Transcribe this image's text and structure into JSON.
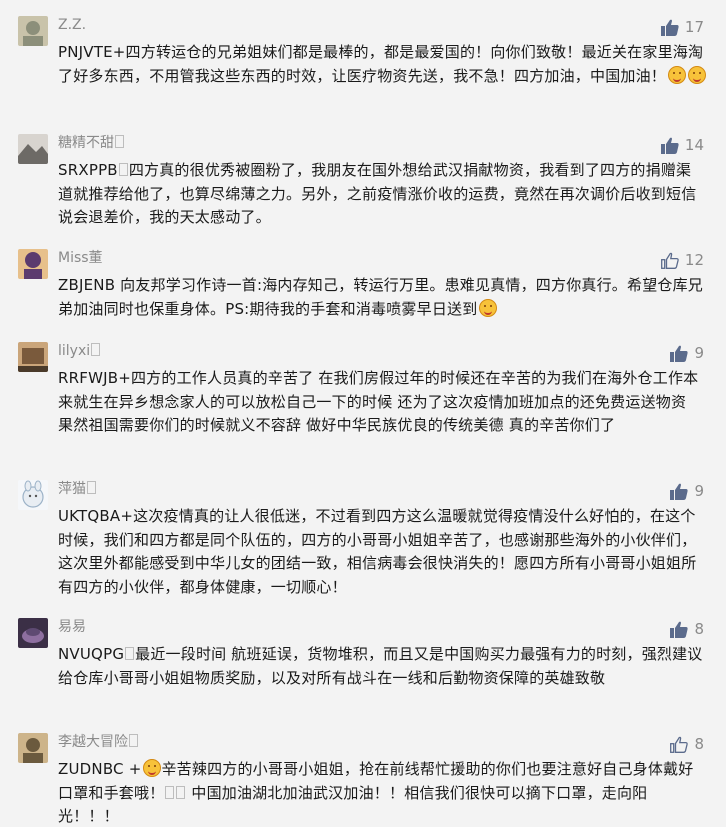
{
  "comments": [
    {
      "name": "Z.Z.",
      "likes": "17",
      "liked": true,
      "avatar_colors": [
        "#8c8f7a",
        "#c9c3aa"
      ],
      "avatar_icon": "avatar-photo-icon",
      "text": "PNJVTE+四方转运仓的兄弟姐妹们都是最棒的，都是最爱国的！向你们致敬！最近关在家里海淘了好多东西，不用管我这些东西的时效，让医疗物资先送，我不急！四方加油，中国加油！",
      "emojis": 2
    },
    {
      "name": "糖精不甜",
      "likes": "14",
      "liked": true,
      "avatar_colors": [
        "#6d6a66",
        "#d8d4cf"
      ],
      "avatar_icon": "avatar-photo-icon",
      "text": "SRXPPB",
      "text_rest": "四方真的很优秀被圈粉了，我朋友在国外想给武汉捐献物资，我看到了四方的捐赠渠道就推荐给他了，也算尽绵薄之力。另外，之前疫情涨价收的运费，竟然在再次调价后收到短信说会退差价，我的天太感动了。"
    },
    {
      "name": "Miss董",
      "likes": "12",
      "liked": false,
      "avatar_colors": [
        "#5b3b6e",
        "#e7c08b"
      ],
      "avatar_icon": "avatar-photo-icon",
      "text": "ZBJENB 向友邦学习作诗一首:海内存知己，转运行万里。患难见真情，四方你真行。希望仓库兄弟加油同时也保重身体。PS:期待我的手套和消毒喷雾早日送到",
      "emojis": 1
    },
    {
      "name": "lilyxi",
      "likes": "9",
      "liked": true,
      "avatar_colors": [
        "#7a5a3c",
        "#caa57a"
      ],
      "avatar_icon": "avatar-photo-icon",
      "text": "RRFWJB+四方的工作人员真的辛苦了 在我们房假过年的时候还在辛苦的为我们在海外仓工作本来就生在异乡想念家人的可以放松自己一下的时候 还为了这次疫情加班加点的还免费运送物资 果然祖国需要你们的时候就义不容辞 做好中华民族优良的传统美德 真的辛苦你们了"
    },
    {
      "name": "萍猫",
      "likes": "9",
      "liked": true,
      "avatar_colors": [
        "#e8edf3",
        "#9db3c8"
      ],
      "avatar_icon": "avatar-cartoon-icon",
      "text": "UKTQBA+这次疫情真的让人很低迷，不过看到四方这么温暖就觉得疫情没什么好怕的，在这个时候，我们和四方都是同个队伍的，四方的小哥哥小姐姐辛苦了，也感谢那些海外的小伙伴们，这次里外都能感受到中华儿女的团结一致，相信病毒会很快消失的！愿四方所有小哥哥小姐姐所有四方的小伙伴，都身体健康，一切顺心！"
    },
    {
      "name": "易易",
      "likes": "8",
      "liked": true,
      "avatar_colors": [
        "#3b2f46",
        "#8e6fa0"
      ],
      "avatar_icon": "avatar-photo-icon",
      "text": "NVUQPG",
      "text_rest": "最近一段时间 航班延误，货物堆积，而且又是中国购买力最强有力的时刻，强烈建议给仓库小哥哥小姐姐物质奖励，以及对所有战斗在一线和后勤物资保障的英雄致敬"
    },
    {
      "name": "李越大冒险",
      "likes": "8",
      "liked": false,
      "avatar_colors": [
        "#6b5a3e",
        "#cdb48a"
      ],
      "avatar_icon": "avatar-photo-icon",
      "text": "ZUDNBC +",
      "text_rest": "辛苦辣四方的小哥哥小姐姐，抢在前线帮忙援助的你们也要注意好自己身体戴好口罩和手套哦！",
      "text_tail": " 中国加油湖北加油武汉加油！！相信我们很快可以摘下口罩，走向阳光！！！"
    }
  ],
  "colors": {
    "like_filled": "#5b6b8c",
    "like_outline": "#5b6b8c",
    "name": "#8a8a8a",
    "text": "#1a1a1a",
    "background": "#f3f3f3"
  }
}
